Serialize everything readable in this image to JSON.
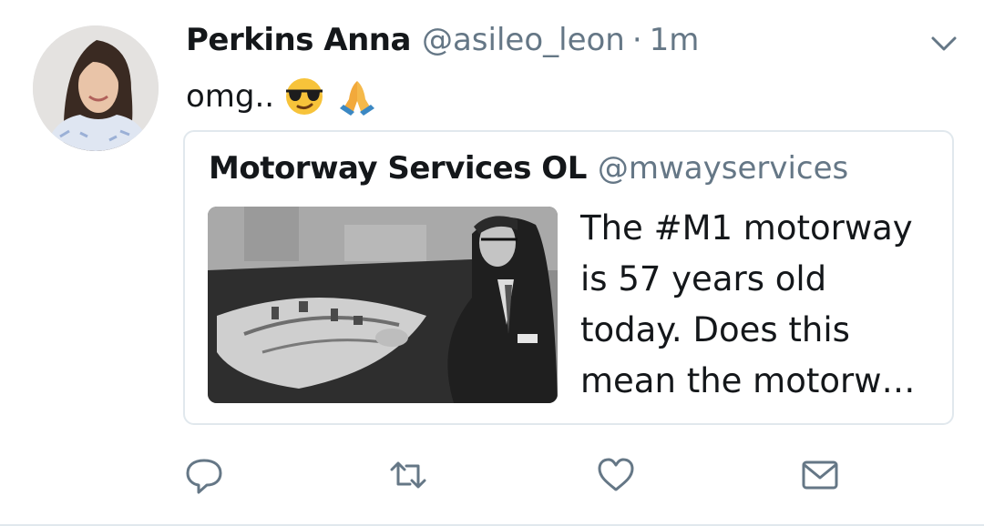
{
  "colors": {
    "primary_text": "#14171a",
    "secondary_text": "#657786",
    "border": "#e1e8ed",
    "icon": "#657786"
  },
  "tweet": {
    "author": {
      "name": "Perkins Anna",
      "handle": "@asileo_leon",
      "avatar_icon": "profile-photo"
    },
    "separator": "·",
    "timestamp": "1m",
    "menu_icon": "chevron-down-icon",
    "text": "omg..",
    "emojis": [
      "sunglasses-emoji",
      "folded-hands-emoji"
    ],
    "quoted_tweet": {
      "author_name": "Motorway Services OL",
      "author_handle": "@mwayservices",
      "text": "The #M1 motorway\nis 57 years old\ntoday. Does this\nmean the motorw…",
      "media_icon": "black-and-white-photo"
    },
    "actions": [
      {
        "name": "reply",
        "icon": "reply-icon"
      },
      {
        "name": "retweet",
        "icon": "retweet-icon"
      },
      {
        "name": "like",
        "icon": "heart-icon"
      },
      {
        "name": "direct-message",
        "icon": "envelope-icon"
      }
    ]
  }
}
